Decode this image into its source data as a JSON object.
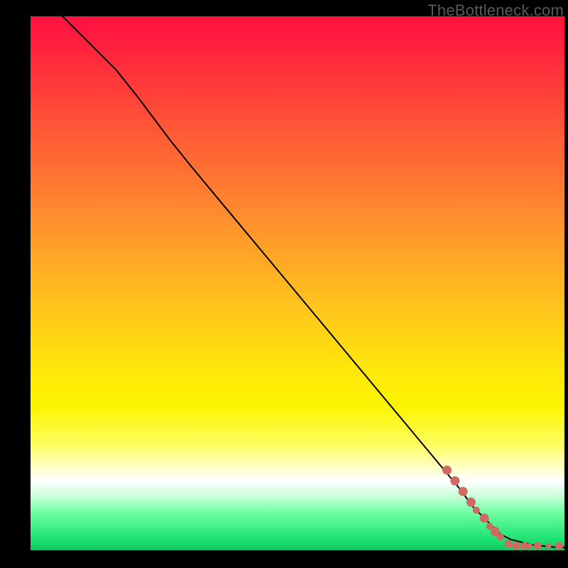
{
  "watermark": "TheBottleneck.com",
  "chart_data": {
    "type": "line",
    "title": "",
    "xlabel": "",
    "ylabel": "",
    "xlim": [
      0,
      100
    ],
    "ylim": [
      0,
      100
    ],
    "grid": false,
    "legend": false,
    "series": [
      {
        "name": "curve",
        "color": "#000000",
        "x": [
          6,
          10,
          16,
          20,
          23,
          26,
          30,
          35,
          40,
          45,
          50,
          55,
          60,
          65,
          70,
          75,
          80,
          83,
          85,
          87,
          88,
          90,
          92,
          94,
          96,
          98,
          100
        ],
        "y": [
          100,
          96,
          90,
          85,
          81,
          77,
          72,
          66,
          60,
          54,
          48,
          42,
          36,
          30,
          24,
          18,
          12,
          8,
          6,
          4,
          3,
          2,
          1.5,
          1,
          0.8,
          0.6,
          0.5
        ]
      }
    ],
    "markers": [
      {
        "name": "cluster-upper",
        "color": "#cf6b64",
        "points": [
          {
            "x": 78,
            "y": 15,
            "r": 6.5
          },
          {
            "x": 79.5,
            "y": 13,
            "r": 6.5
          },
          {
            "x": 81,
            "y": 11,
            "r": 6.5
          },
          {
            "x": 82.5,
            "y": 9,
            "r": 6.5
          },
          {
            "x": 83.5,
            "y": 7.5,
            "r": 5
          },
          {
            "x": 85,
            "y": 6,
            "r": 6.5
          },
          {
            "x": 86,
            "y": 4.5,
            "r": 5
          },
          {
            "x": 87,
            "y": 3.5,
            "r": 6.5
          },
          {
            "x": 88,
            "y": 2.5,
            "r": 5
          }
        ]
      },
      {
        "name": "cluster-lower",
        "color": "#cf6b64",
        "points": [
          {
            "x": 89.5,
            "y": 1.2,
            "r": 5.5
          },
          {
            "x": 91,
            "y": 0.8,
            "r": 5.5
          },
          {
            "x": 92.5,
            "y": 0.8,
            "r": 5.5
          },
          {
            "x": 93.5,
            "y": 0.8,
            "r": 4
          },
          {
            "x": 95,
            "y": 0.8,
            "r": 5.5
          },
          {
            "x": 97,
            "y": 0.8,
            "r": 4
          },
          {
            "x": 99,
            "y": 0.8,
            "r": 5.5
          }
        ]
      }
    ]
  }
}
